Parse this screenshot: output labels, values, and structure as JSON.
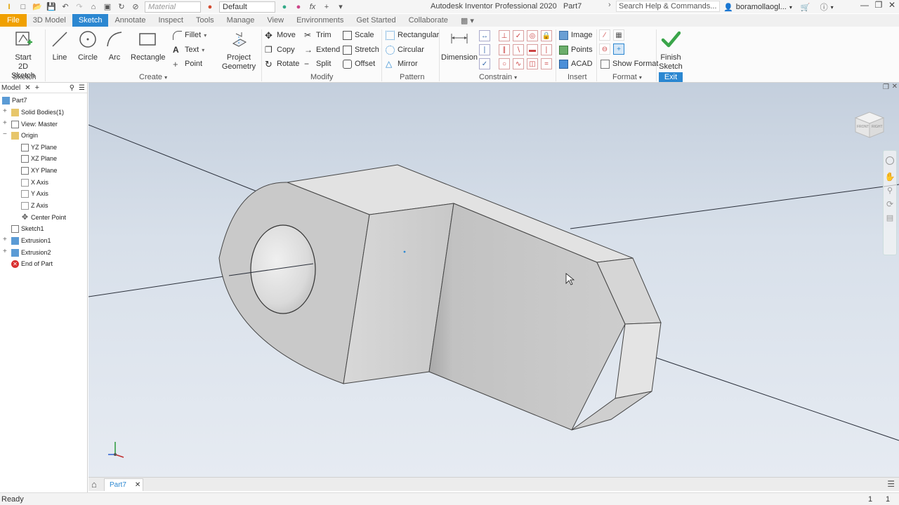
{
  "quick_access": {
    "material_placeholder": "Material",
    "appearance_value": "Default"
  },
  "window": {
    "app_title": "Autodesk Inventor Professional 2020",
    "document": "Part7",
    "search_placeholder": "Search Help & Commands...",
    "user": "boramollaogl..."
  },
  "tabs": [
    {
      "label": "File"
    },
    {
      "label": "3D Model"
    },
    {
      "label": "Sketch"
    },
    {
      "label": "Annotate"
    },
    {
      "label": "Inspect"
    },
    {
      "label": "Tools"
    },
    {
      "label": "Manage"
    },
    {
      "label": "View"
    },
    {
      "label": "Environments"
    },
    {
      "label": "Get Started"
    },
    {
      "label": "Collaborate"
    }
  ],
  "ribbon": {
    "sketch": {
      "start_line1": "Start",
      "start_line2": "2D Sketch",
      "panel": "Sketch"
    },
    "create": {
      "line": "Line",
      "circle": "Circle",
      "arc": "Arc",
      "rectangle": "Rectangle",
      "fillet": "Fillet",
      "text": "Text",
      "point": "Point",
      "project_line1": "Project",
      "project_line2": "Geometry",
      "panel": "Create"
    },
    "modify": {
      "move": "Move",
      "copy": "Copy",
      "rotate": "Rotate",
      "trim": "Trim",
      "extend": "Extend",
      "split": "Split",
      "scale": "Scale",
      "stretch": "Stretch",
      "offset": "Offset",
      "panel": "Modify"
    },
    "pattern": {
      "rectangular": "Rectangular",
      "circular": "Circular",
      "mirror": "Mirror",
      "panel": "Pattern"
    },
    "constrain": {
      "dimension": "Dimension",
      "panel": "Constrain"
    },
    "insert": {
      "image": "Image",
      "points": "Points",
      "acad": "ACAD",
      "panel": "Insert"
    },
    "format": {
      "show_format": "Show Format",
      "panel": "Format"
    },
    "exit": {
      "finish_line1": "Finish",
      "finish_line2": "Sketch",
      "panel": "Exit"
    }
  },
  "browser": {
    "tab": "Model",
    "items": [
      {
        "label": "Part7"
      },
      {
        "label": "Solid Bodies(1)"
      },
      {
        "label": "View: Master"
      },
      {
        "label": "Origin"
      },
      {
        "label": "YZ Plane"
      },
      {
        "label": "XZ Plane"
      },
      {
        "label": "XY Plane"
      },
      {
        "label": "X Axis"
      },
      {
        "label": "Y Axis"
      },
      {
        "label": "Z Axis"
      },
      {
        "label": "Center Point"
      },
      {
        "label": "Sketch1"
      },
      {
        "label": "Extrusion1"
      },
      {
        "label": "Extrusion2"
      },
      {
        "label": "End of Part"
      }
    ]
  },
  "viewcube": {
    "face1": "FRONT",
    "face2": "RIGHT"
  },
  "document_tab": {
    "label": "Part7"
  },
  "status": {
    "text": "Ready",
    "count1": "1",
    "count2": "1"
  },
  "colors": {
    "accent": "#2b87d1",
    "file_tab": "#f0a000",
    "finish_green": "#3aa54a"
  }
}
